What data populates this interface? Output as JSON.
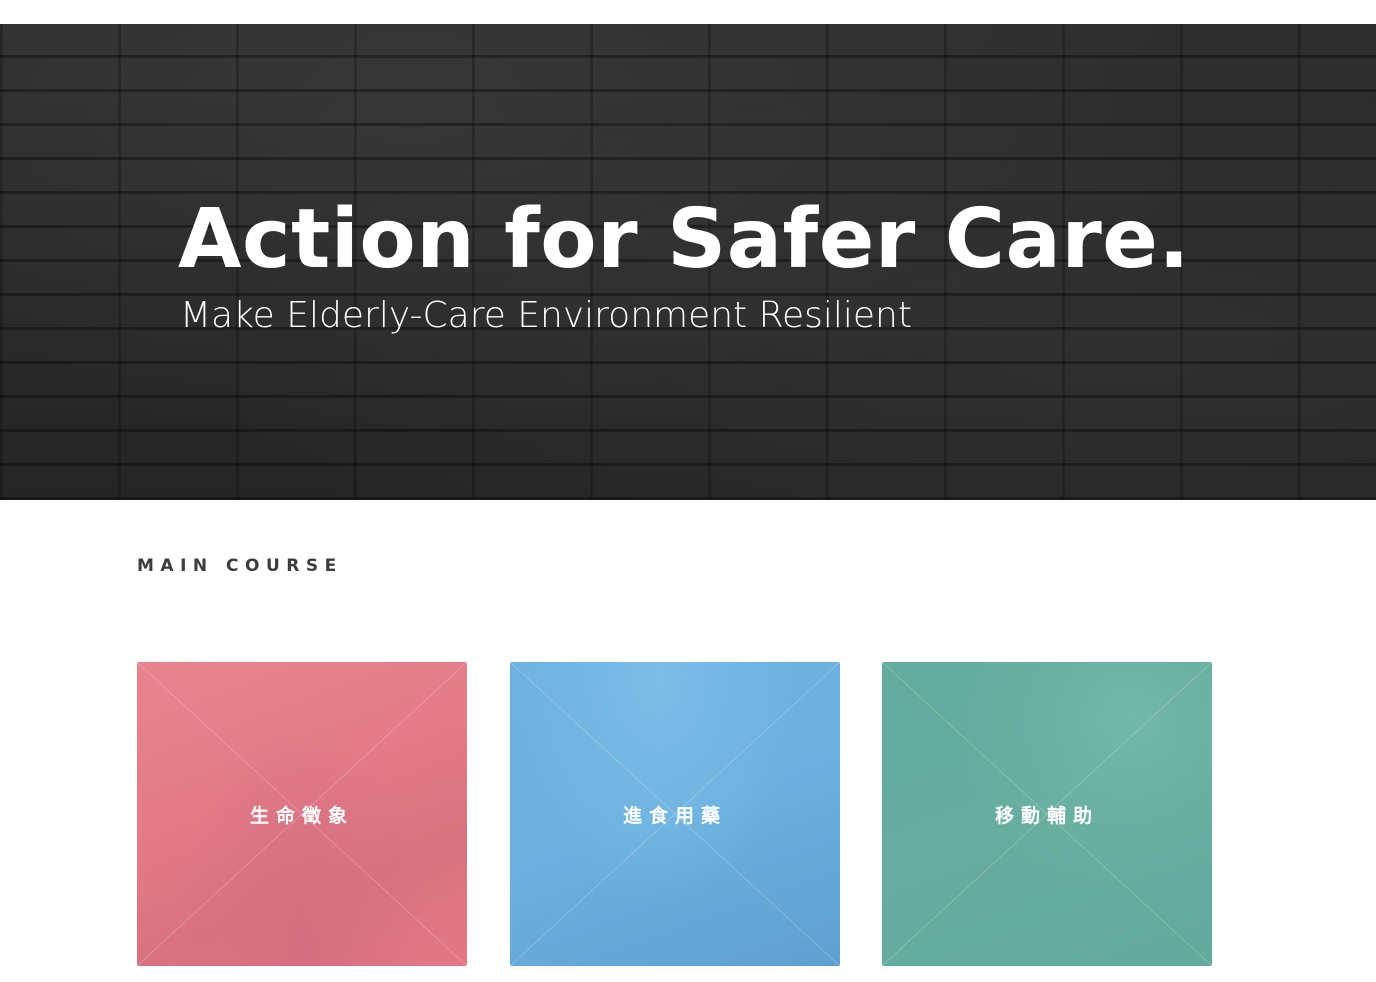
{
  "hero": {
    "title": "Action for Safer Care.",
    "subtitle": "Make Elderly-Care Environment Resilient",
    "background": "dark-brick-wall"
  },
  "main_course": {
    "heading": "MAIN COURSE",
    "cards": [
      {
        "label": "生命徵象",
        "color": "#e37a88"
      },
      {
        "label": "進食用藥",
        "color": "#6bb0de"
      },
      {
        "label": "移動輔助",
        "color": "#64ac9e"
      }
    ]
  }
}
